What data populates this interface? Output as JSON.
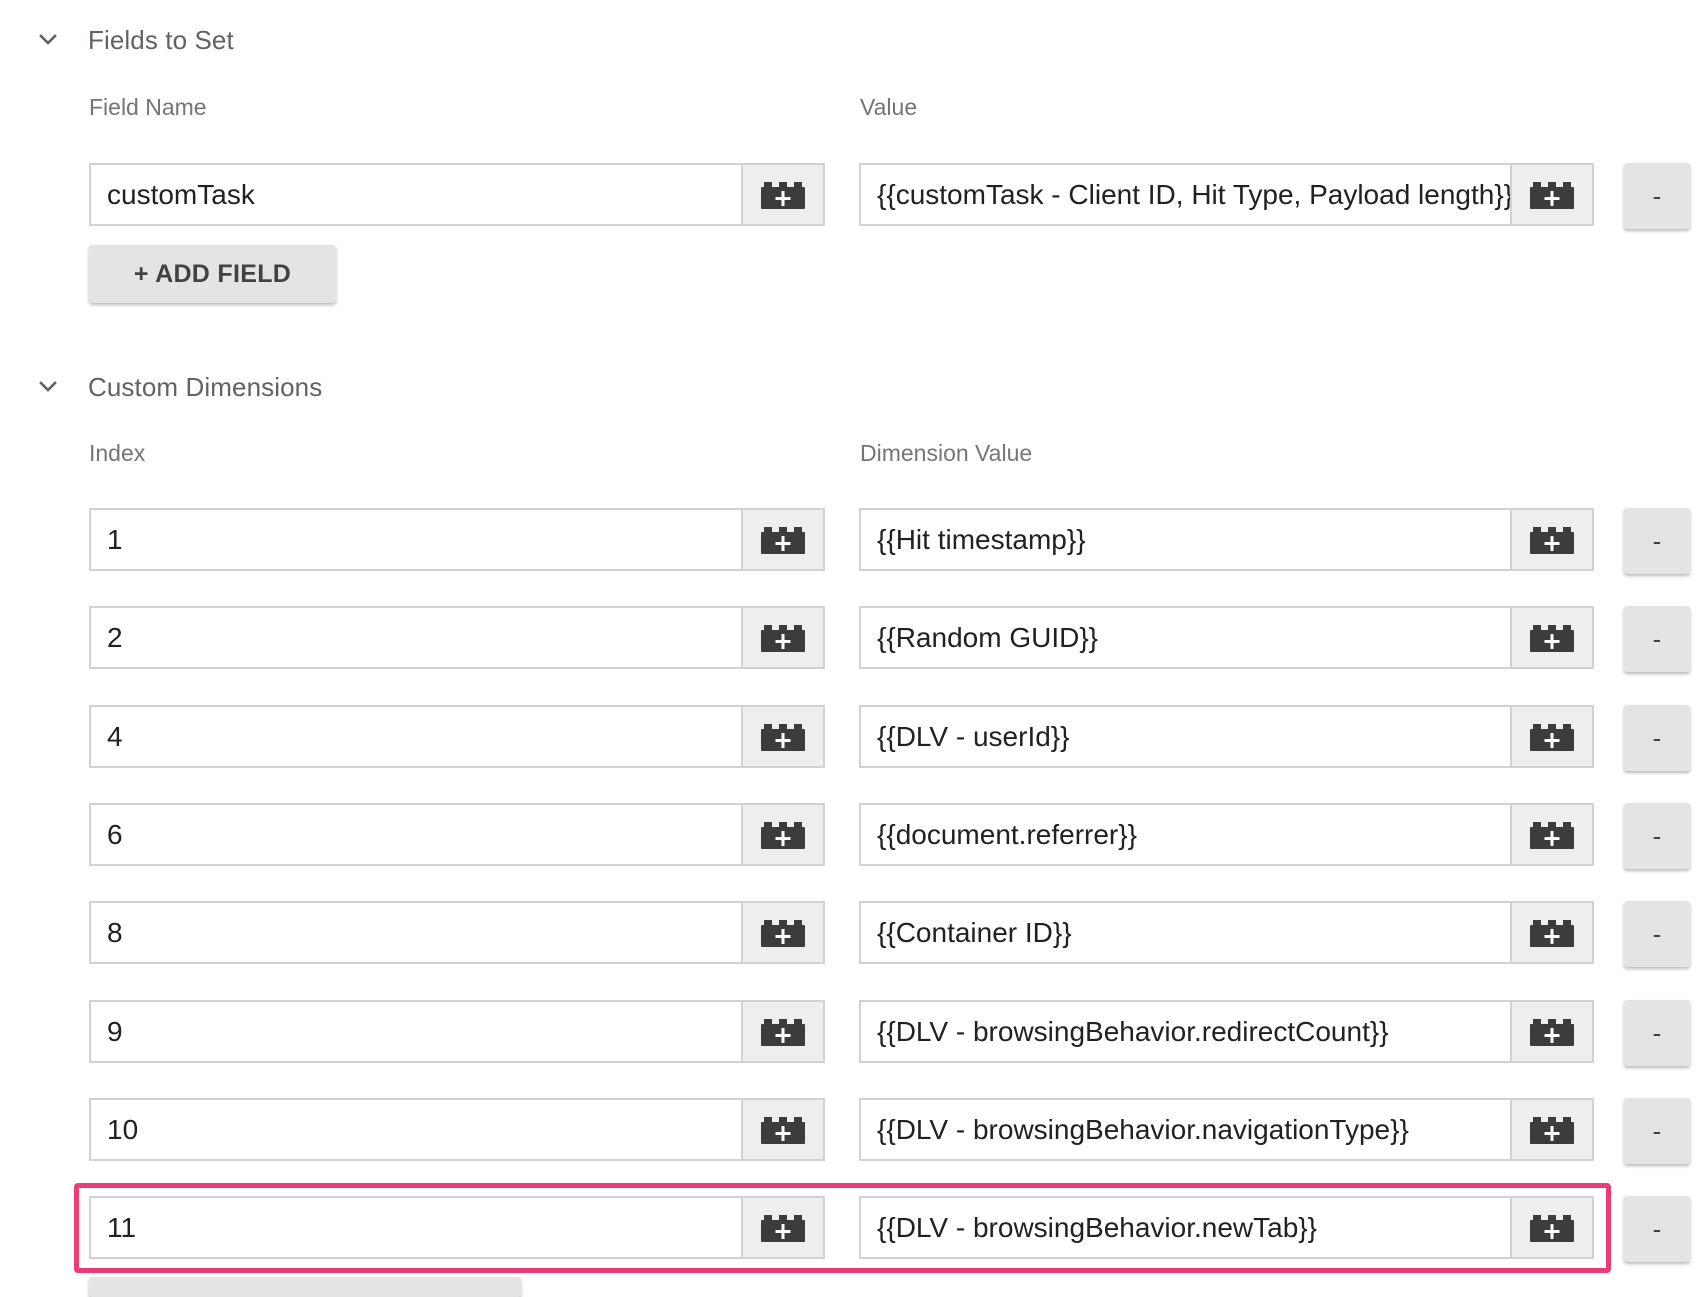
{
  "fields_to_set": {
    "title": "Fields to Set",
    "col_name_label": "Field Name",
    "col_value_label": "Value",
    "rows": [
      {
        "name": "customTask",
        "value": "{{customTask - Client ID, Hit Type, Payload length}}"
      }
    ],
    "add_label": "+ ADD FIELD",
    "remove_label": "-"
  },
  "custom_dimensions": {
    "title": "Custom Dimensions",
    "col_index_label": "Index",
    "col_value_label": "Dimension Value",
    "rows": [
      {
        "index": "1",
        "value": "{{Hit timestamp}}"
      },
      {
        "index": "2",
        "value": "{{Random GUID}}"
      },
      {
        "index": "4",
        "value": "{{DLV - userId}}"
      },
      {
        "index": "6",
        "value": "{{document.referrer}}"
      },
      {
        "index": "8",
        "value": "{{Container ID}}"
      },
      {
        "index": "9",
        "value": "{{DLV - browsingBehavior.redirectCount}}"
      },
      {
        "index": "10",
        "value": "{{DLV - browsingBehavior.navigationType}}"
      },
      {
        "index": "11",
        "value": "{{DLV - browsingBehavior.newTab}}"
      }
    ],
    "highlighted_row_index": "11",
    "remove_label": "-"
  },
  "icons": {
    "section_toggle": "chevron-down-icon",
    "variable_picker": "variable-block-plus-icon"
  },
  "colors": {
    "highlight": "#ec3c78",
    "label": "#757575",
    "button_bg": "#e4e4e4"
  }
}
